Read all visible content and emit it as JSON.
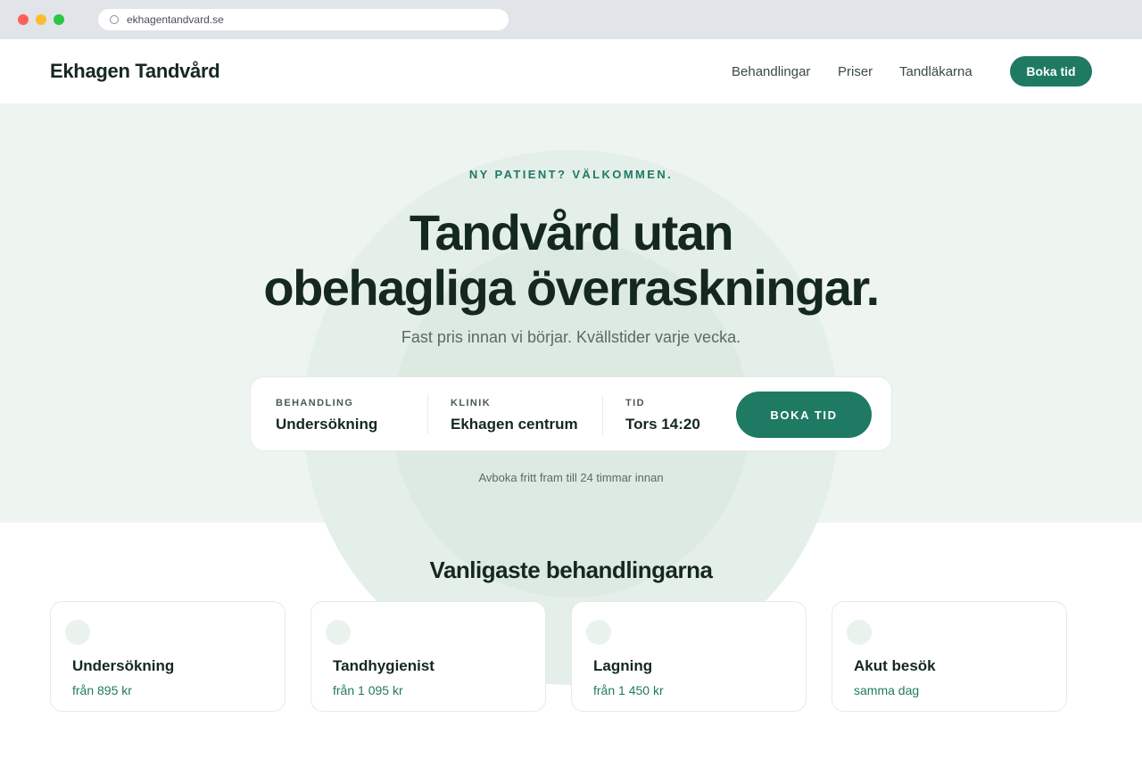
{
  "browser": {
    "url": "ekhagentandvard.se"
  },
  "header": {
    "logo": "Ekhagen Tandvård",
    "nav": [
      "Behandlingar",
      "Priser",
      "Tandläkarna"
    ],
    "cta_label": "Boka tid"
  },
  "hero": {
    "eyebrow": "NY PATIENT? VÄLKOMMEN.",
    "headline_line1": "Tandvård utan",
    "headline_line2": "obehagliga överraskningar.",
    "subhead": "Fast pris innan vi börjar. Kvällstider varje vecka.",
    "booking": {
      "fields": [
        {
          "label": "BEHANDLING",
          "value": "Undersökning"
        },
        {
          "label": "KLINIK",
          "value": "Ekhagen centrum"
        },
        {
          "label": "TID",
          "value": "Tors 14:20"
        }
      ],
      "button_label": "BOKA TID"
    },
    "note": "Avboka fritt fram till 24 timmar innan"
  },
  "treatments": {
    "title": "Vanligaste behandlingarna",
    "cards": [
      {
        "title": "Undersökning",
        "price": "från 895 kr"
      },
      {
        "title": "Tandhygienist",
        "price": "från 1 095 kr"
      },
      {
        "title": "Lagning",
        "price": "från 1 450 kr"
      },
      {
        "title": "Akut besök",
        "price": "samma dag"
      }
    ]
  },
  "colors": {
    "brand": "#1f7a63",
    "hero_bg": "#eef5f1",
    "text": "#15281f"
  }
}
